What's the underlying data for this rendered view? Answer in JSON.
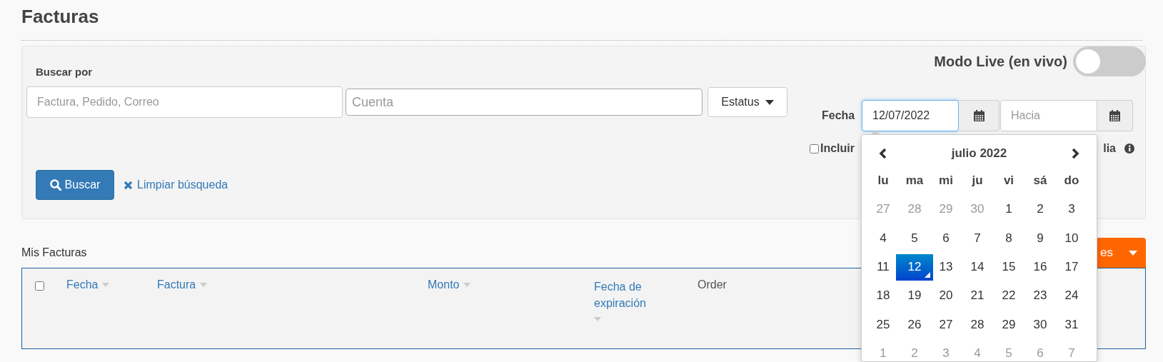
{
  "page": {
    "title": "Facturas"
  },
  "filters": {
    "live_mode": {
      "label": "Modo Live (en vivo)",
      "on": false
    },
    "search_label": "Buscar por",
    "search_field": {
      "placeholder": "Factura, Pedido, Correo"
    },
    "account_field": {
      "placeholder": "Cuenta"
    },
    "status_button": "Estatus",
    "date_label": "Fecha",
    "date_from": {
      "value": "12/07/2022",
      "focused": true
    },
    "date_to": {
      "placeholder": "Hacia"
    },
    "include_checkbox": {
      "label_start": "Incluir",
      "label_end": "lia",
      "checked": false
    },
    "search_button": "Buscar",
    "clear_link": "Limpiar búsqueda"
  },
  "datepicker": {
    "month": "julio 2022",
    "weekdays": [
      "lu",
      "ma",
      "mi",
      "ju",
      "vi",
      "sá",
      "do"
    ],
    "weeks": [
      [
        {
          "day": "27",
          "muted": true,
          "selected": false
        },
        {
          "day": "28",
          "muted": true,
          "selected": false
        },
        {
          "day": "29",
          "muted": true,
          "selected": false
        },
        {
          "day": "30",
          "muted": true,
          "selected": false
        },
        {
          "day": "1",
          "muted": false,
          "selected": false
        },
        {
          "day": "2",
          "muted": false,
          "selected": false
        },
        {
          "day": "3",
          "muted": false,
          "selected": false
        }
      ],
      [
        {
          "day": "4",
          "muted": false,
          "selected": false
        },
        {
          "day": "5",
          "muted": false,
          "selected": false
        },
        {
          "day": "6",
          "muted": false,
          "selected": false
        },
        {
          "day": "7",
          "muted": false,
          "selected": false
        },
        {
          "day": "8",
          "muted": false,
          "selected": false
        },
        {
          "day": "9",
          "muted": false,
          "selected": false
        },
        {
          "day": "10",
          "muted": false,
          "selected": false
        }
      ],
      [
        {
          "day": "11",
          "muted": false,
          "selected": false
        },
        {
          "day": "12",
          "muted": false,
          "selected": true
        },
        {
          "day": "13",
          "muted": false,
          "selected": false
        },
        {
          "day": "14",
          "muted": false,
          "selected": false
        },
        {
          "day": "15",
          "muted": false,
          "selected": false
        },
        {
          "day": "16",
          "muted": false,
          "selected": false
        },
        {
          "day": "17",
          "muted": false,
          "selected": false
        }
      ],
      [
        {
          "day": "18",
          "muted": false,
          "selected": false
        },
        {
          "day": "19",
          "muted": false,
          "selected": false
        },
        {
          "day": "20",
          "muted": false,
          "selected": false
        },
        {
          "day": "21",
          "muted": false,
          "selected": false
        },
        {
          "day": "22",
          "muted": false,
          "selected": false
        },
        {
          "day": "23",
          "muted": false,
          "selected": false
        },
        {
          "day": "24",
          "muted": false,
          "selected": false
        }
      ],
      [
        {
          "day": "25",
          "muted": false,
          "selected": false
        },
        {
          "day": "26",
          "muted": false,
          "selected": false
        },
        {
          "day": "27",
          "muted": false,
          "selected": false
        },
        {
          "day": "28",
          "muted": false,
          "selected": false
        },
        {
          "day": "29",
          "muted": false,
          "selected": false
        },
        {
          "day": "30",
          "muted": false,
          "selected": false
        },
        {
          "day": "31",
          "muted": false,
          "selected": false
        }
      ],
      [
        {
          "day": "1",
          "muted": true,
          "selected": false
        },
        {
          "day": "2",
          "muted": true,
          "selected": false
        },
        {
          "day": "3",
          "muted": true,
          "selected": false
        },
        {
          "day": "4",
          "muted": true,
          "selected": false
        },
        {
          "day": "5",
          "muted": true,
          "selected": false
        },
        {
          "day": "6",
          "muted": true,
          "selected": false
        },
        {
          "day": "7",
          "muted": true,
          "selected": false
        }
      ]
    ]
  },
  "invoices": {
    "title": "Mis Facturas",
    "actions_button": "es",
    "select_all": {
      "checked": false
    },
    "columns": [
      {
        "label": "Fecha",
        "sortable": true
      },
      {
        "label": "Factura",
        "sortable": true
      },
      {
        "label": "Monto",
        "sortable": true
      },
      {
        "label": "Fecha de expiración",
        "sortable": true
      },
      {
        "label": "Order",
        "sortable": false
      }
    ]
  }
}
